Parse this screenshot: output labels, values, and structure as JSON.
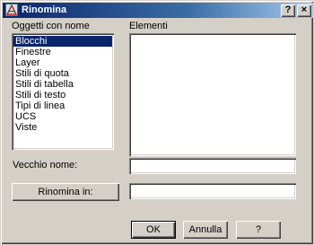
{
  "window": {
    "title": "Rinomina",
    "help_button": "?",
    "close_button": "×"
  },
  "named_objects": {
    "label": "Oggetti con nome",
    "items": [
      "Blocchi",
      "Finestre",
      "Layer",
      "Stili di quota",
      "Stili di tabella",
      "Stili di testo",
      "Tipi di linea",
      "UCS",
      "Viste"
    ],
    "selected_index": 0
  },
  "elements": {
    "label": "Elementi",
    "items": []
  },
  "old_name": {
    "label": "Vecchio nome:",
    "value": ""
  },
  "rename_to": {
    "button_label": "Rinomina in:",
    "value": ""
  },
  "footer": {
    "ok_label": "OK",
    "cancel_label": "Annulla",
    "help_label": "?"
  },
  "colors": {
    "dialog_bg": "#d4d0c8",
    "title_bar": "#0a246a",
    "selection": "#0a246a"
  }
}
